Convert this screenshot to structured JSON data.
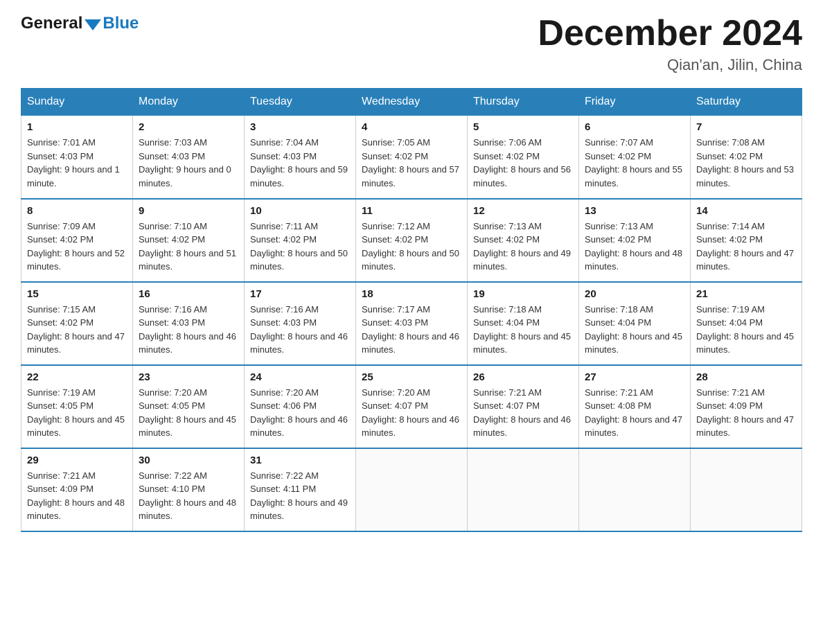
{
  "logo": {
    "general": "General",
    "blue": "Blue"
  },
  "title": "December 2024",
  "location": "Qian'an, Jilin, China",
  "headers": [
    "Sunday",
    "Monday",
    "Tuesday",
    "Wednesday",
    "Thursday",
    "Friday",
    "Saturday"
  ],
  "weeks": [
    [
      {
        "day": "1",
        "sunrise": "7:01 AM",
        "sunset": "4:03 PM",
        "daylight": "9 hours and 1 minute."
      },
      {
        "day": "2",
        "sunrise": "7:03 AM",
        "sunset": "4:03 PM",
        "daylight": "9 hours and 0 minutes."
      },
      {
        "day": "3",
        "sunrise": "7:04 AM",
        "sunset": "4:03 PM",
        "daylight": "8 hours and 59 minutes."
      },
      {
        "day": "4",
        "sunrise": "7:05 AM",
        "sunset": "4:02 PM",
        "daylight": "8 hours and 57 minutes."
      },
      {
        "day": "5",
        "sunrise": "7:06 AM",
        "sunset": "4:02 PM",
        "daylight": "8 hours and 56 minutes."
      },
      {
        "day": "6",
        "sunrise": "7:07 AM",
        "sunset": "4:02 PM",
        "daylight": "8 hours and 55 minutes."
      },
      {
        "day": "7",
        "sunrise": "7:08 AM",
        "sunset": "4:02 PM",
        "daylight": "8 hours and 53 minutes."
      }
    ],
    [
      {
        "day": "8",
        "sunrise": "7:09 AM",
        "sunset": "4:02 PM",
        "daylight": "8 hours and 52 minutes."
      },
      {
        "day": "9",
        "sunrise": "7:10 AM",
        "sunset": "4:02 PM",
        "daylight": "8 hours and 51 minutes."
      },
      {
        "day": "10",
        "sunrise": "7:11 AM",
        "sunset": "4:02 PM",
        "daylight": "8 hours and 50 minutes."
      },
      {
        "day": "11",
        "sunrise": "7:12 AM",
        "sunset": "4:02 PM",
        "daylight": "8 hours and 50 minutes."
      },
      {
        "day": "12",
        "sunrise": "7:13 AM",
        "sunset": "4:02 PM",
        "daylight": "8 hours and 49 minutes."
      },
      {
        "day": "13",
        "sunrise": "7:13 AM",
        "sunset": "4:02 PM",
        "daylight": "8 hours and 48 minutes."
      },
      {
        "day": "14",
        "sunrise": "7:14 AM",
        "sunset": "4:02 PM",
        "daylight": "8 hours and 47 minutes."
      }
    ],
    [
      {
        "day": "15",
        "sunrise": "7:15 AM",
        "sunset": "4:02 PM",
        "daylight": "8 hours and 47 minutes."
      },
      {
        "day": "16",
        "sunrise": "7:16 AM",
        "sunset": "4:03 PM",
        "daylight": "8 hours and 46 minutes."
      },
      {
        "day": "17",
        "sunrise": "7:16 AM",
        "sunset": "4:03 PM",
        "daylight": "8 hours and 46 minutes."
      },
      {
        "day": "18",
        "sunrise": "7:17 AM",
        "sunset": "4:03 PM",
        "daylight": "8 hours and 46 minutes."
      },
      {
        "day": "19",
        "sunrise": "7:18 AM",
        "sunset": "4:04 PM",
        "daylight": "8 hours and 45 minutes."
      },
      {
        "day": "20",
        "sunrise": "7:18 AM",
        "sunset": "4:04 PM",
        "daylight": "8 hours and 45 minutes."
      },
      {
        "day": "21",
        "sunrise": "7:19 AM",
        "sunset": "4:04 PM",
        "daylight": "8 hours and 45 minutes."
      }
    ],
    [
      {
        "day": "22",
        "sunrise": "7:19 AM",
        "sunset": "4:05 PM",
        "daylight": "8 hours and 45 minutes."
      },
      {
        "day": "23",
        "sunrise": "7:20 AM",
        "sunset": "4:05 PM",
        "daylight": "8 hours and 45 minutes."
      },
      {
        "day": "24",
        "sunrise": "7:20 AM",
        "sunset": "4:06 PM",
        "daylight": "8 hours and 46 minutes."
      },
      {
        "day": "25",
        "sunrise": "7:20 AM",
        "sunset": "4:07 PM",
        "daylight": "8 hours and 46 minutes."
      },
      {
        "day": "26",
        "sunrise": "7:21 AM",
        "sunset": "4:07 PM",
        "daylight": "8 hours and 46 minutes."
      },
      {
        "day": "27",
        "sunrise": "7:21 AM",
        "sunset": "4:08 PM",
        "daylight": "8 hours and 47 minutes."
      },
      {
        "day": "28",
        "sunrise": "7:21 AM",
        "sunset": "4:09 PM",
        "daylight": "8 hours and 47 minutes."
      }
    ],
    [
      {
        "day": "29",
        "sunrise": "7:21 AM",
        "sunset": "4:09 PM",
        "daylight": "8 hours and 48 minutes."
      },
      {
        "day": "30",
        "sunrise": "7:22 AM",
        "sunset": "4:10 PM",
        "daylight": "8 hours and 48 minutes."
      },
      {
        "day": "31",
        "sunrise": "7:22 AM",
        "sunset": "4:11 PM",
        "daylight": "8 hours and 49 minutes."
      },
      null,
      null,
      null,
      null
    ]
  ]
}
